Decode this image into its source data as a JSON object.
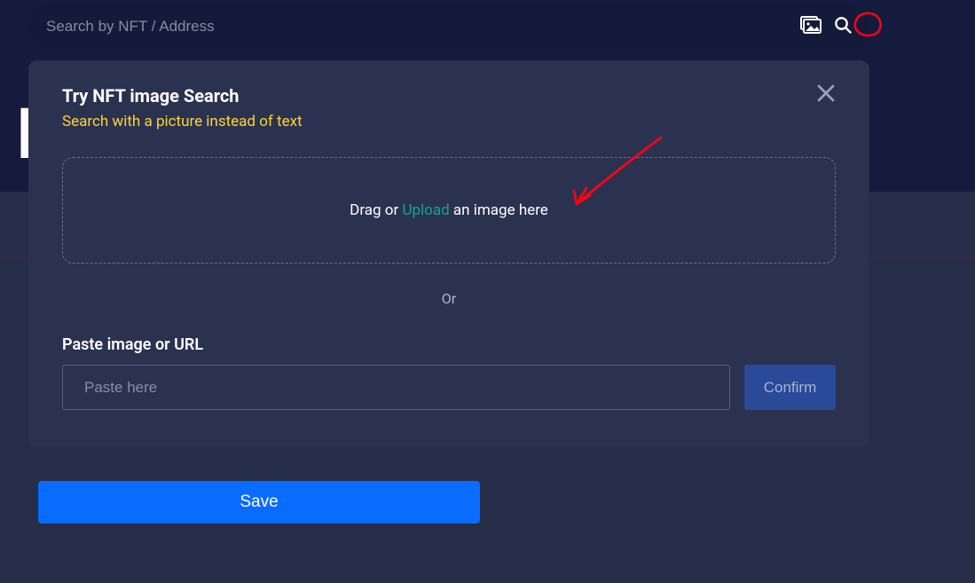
{
  "search": {
    "placeholder": "Search by NFT / Address"
  },
  "banner": {
    "letter": "N"
  },
  "modal": {
    "title": "Try NFT image Search",
    "subtitle": "Search with a picture instead of text",
    "drop_pre": "Drag or ",
    "drop_link": "Upload",
    "drop_post": " an image here",
    "or": "Or",
    "paste_label": "Paste image or URL",
    "paste_placeholder": "Paste here",
    "confirm": "Confirm"
  },
  "save": "Save"
}
